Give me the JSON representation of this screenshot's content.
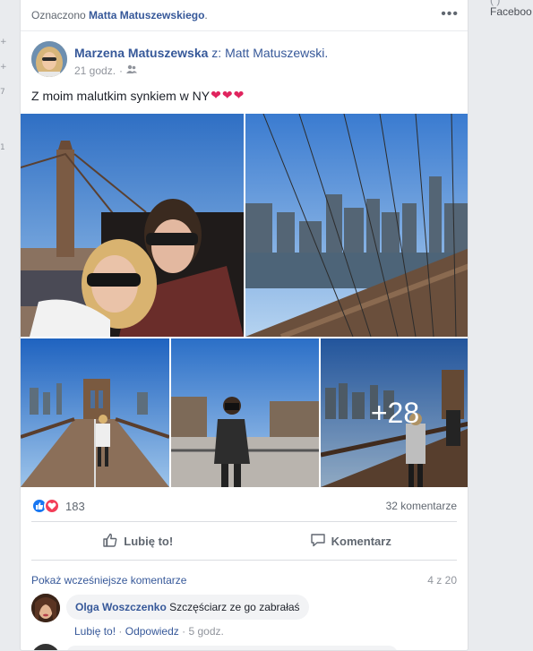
{
  "left_strip": {
    "marks": [
      "+",
      "+",
      "7",
      "1"
    ]
  },
  "right_col": {
    "cutoff_text": "(  )",
    "label": "Faceboo"
  },
  "post": {
    "tagged_prefix": "Oznaczono",
    "tagged_name": "Matta Matuszewskiego",
    "tagged_suffix": ".",
    "more_icon": "ellipsis-icon",
    "author": "Marzena Matuszewska",
    "with_text": "z: Matt Matuszewski.",
    "time": "21 godz.",
    "separator": "·",
    "audience_icon": "friends-icon",
    "text": "Z moim malutkim synkiem w NY",
    "hearts": [
      "❤",
      "❤",
      "❤"
    ],
    "more_photos": "+28"
  },
  "stats": {
    "reactions": [
      "like",
      "love"
    ],
    "reaction_count": "183",
    "comments": "32 komentarze"
  },
  "actions": {
    "like_label": "Lubię to!",
    "comment_label": "Komentarz"
  },
  "comments_section": {
    "show_previous": "Pokaż wcześniejsze komentarze",
    "pager": "4 z 20",
    "comment": {
      "author": "Olga Woszczenko",
      "text": "Szczęściarz ze go zabrałaś",
      "like": "Lubię to!",
      "reply": "Odpowiedz",
      "time": "5 godz.",
      "dot": "·"
    }
  },
  "colors": {
    "link": "#365899",
    "like_blue": "#1877f2",
    "love_red": "#f33e58",
    "heart": "#e0245e",
    "sky": "#3b7fd0"
  }
}
